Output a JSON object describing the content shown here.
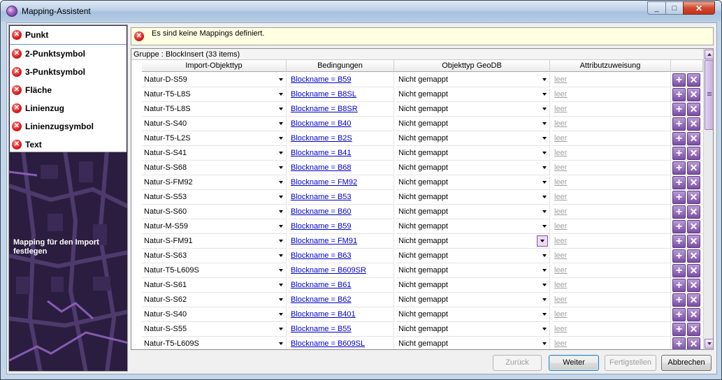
{
  "window": {
    "title": "Mapping-Assistent",
    "minimize_glyph": "_",
    "maximize_glyph": "□",
    "close_glyph": "✕"
  },
  "nav": {
    "items": [
      {
        "label": "Punkt",
        "icon": "error-icon",
        "selected": true
      },
      {
        "label": "2-Punktsymbol",
        "icon": "error-icon"
      },
      {
        "label": "3-Punktsymbol",
        "icon": "error-icon"
      },
      {
        "label": "Fläche",
        "icon": "error-icon"
      },
      {
        "label": "Linienzug",
        "icon": "error-icon"
      },
      {
        "label": "Linienzugsymbol",
        "icon": "error-icon"
      },
      {
        "label": "Text",
        "icon": "error-icon"
      }
    ],
    "caption": "Mapping für den Import festlegen"
  },
  "message": {
    "icon": "error-icon",
    "text": "Es sind keine Mappings definiert."
  },
  "grid": {
    "group_label": "Gruppe : BlockInsert (33 items)",
    "columns": [
      "Import-Objekttyp",
      "Bedingungen",
      "Objekttyp GeoDB",
      "Attributzuweisung"
    ],
    "rows": [
      {
        "import": "Natur-D-S59",
        "condition": "Blockname = B59",
        "objtype": "Nicht gemappt",
        "attr": "leer"
      },
      {
        "import": "Natur-T5-L8S",
        "condition": "Blockname = B8SL",
        "objtype": "Nicht gemappt",
        "attr": "leer"
      },
      {
        "import": "Natur-T5-L8S",
        "condition": "Blockname = B8SR",
        "objtype": "Nicht gemappt",
        "attr": "leer"
      },
      {
        "import": "Natur-S-S40",
        "condition": "Blockname = B40",
        "objtype": "Nicht gemappt",
        "attr": "leer"
      },
      {
        "import": "Natur-T5-L2S",
        "condition": "Blockname = B2S",
        "objtype": "Nicht gemappt",
        "attr": "leer"
      },
      {
        "import": "Natur-S-S41",
        "condition": "Blockname = B41",
        "objtype": "Nicht gemappt",
        "attr": "leer"
      },
      {
        "import": "Natur-S-S68",
        "condition": "Blockname = B68",
        "objtype": "Nicht gemappt",
        "attr": "leer"
      },
      {
        "import": "Natur-S-FM92",
        "condition": "Blockname = FM92",
        "objtype": "Nicht gemappt",
        "attr": "leer"
      },
      {
        "import": "Natur-S-S53",
        "condition": "Blockname = B53",
        "objtype": "Nicht gemappt",
        "attr": "leer"
      },
      {
        "import": "Natur-S-S60",
        "condition": "Blockname = B60",
        "objtype": "Nicht gemappt",
        "attr": "leer"
      },
      {
        "import": "Natur-M-S59",
        "condition": "Blockname = B59",
        "objtype": "Nicht gemappt",
        "attr": "leer"
      },
      {
        "import": "Natur-S-FM91",
        "condition": "Blockname = FM91",
        "objtype": "Nicht gemappt",
        "attr": "leer",
        "dropdown_focused": true
      },
      {
        "import": "Natur-S-S63",
        "condition": "Blockname = B63",
        "objtype": "Nicht gemappt",
        "attr": "leer"
      },
      {
        "import": "Natur-T5-L609S",
        "condition": "Blockname = B609SR",
        "objtype": "Nicht gemappt",
        "attr": "leer"
      },
      {
        "import": "Natur-S-S61",
        "condition": "Blockname = B61",
        "objtype": "Nicht gemappt",
        "attr": "leer"
      },
      {
        "import": "Natur-S-S62",
        "condition": "Blockname = B62",
        "objtype": "Nicht gemappt",
        "attr": "leer"
      },
      {
        "import": "Natur-S-S40",
        "condition": "Blockname = B401",
        "objtype": "Nicht gemappt",
        "attr": "leer"
      },
      {
        "import": "Natur-S-S55",
        "condition": "Blockname = B55",
        "objtype": "Nicht gemappt",
        "attr": "leer"
      },
      {
        "import": "Natur-T5-L609S",
        "condition": "Blockname = B609SL",
        "objtype": "Nicht gemappt",
        "attr": "leer"
      }
    ],
    "row_actions": {
      "add_glyph": "+",
      "delete_glyph": "✕"
    }
  },
  "footer": {
    "back": "Zurück",
    "next": "Weiter",
    "finish": "Fertigstellen",
    "cancel": "Abbrechen"
  },
  "colors": {
    "accent": "#7a4ea6",
    "error": "#e02020",
    "message_bg": "#ffffe1",
    "link": "#0000cc"
  }
}
